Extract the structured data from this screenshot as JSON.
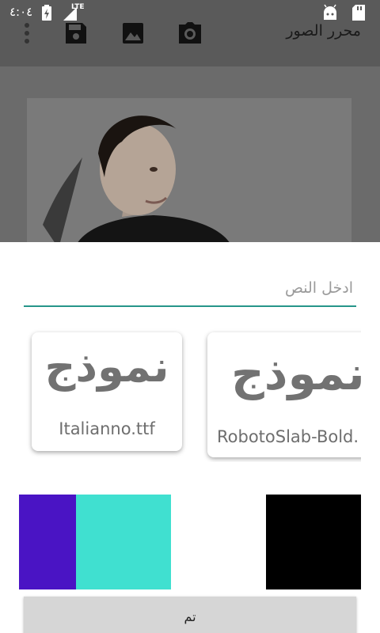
{
  "statusbar": {
    "time": "٤:٠٤",
    "network": "LTE"
  },
  "appbar": {
    "title": "محرر الصور",
    "actions": [
      "camera-icon",
      "image-icon",
      "save-icon",
      "more-icon"
    ]
  },
  "editor": {
    "text_placeholder": "ادخل النص"
  },
  "fonts": [
    {
      "sample": "نموذج",
      "name": "Italianno.ttf"
    },
    {
      "sample": "نموذج",
      "name": "RobotoSlab-Bold."
    }
  ],
  "colors": {
    "swatches": [
      "#4a14c4",
      "#40e0d0",
      "#ffffff",
      "#000000"
    ],
    "accent": "#26968a"
  },
  "footer": {
    "done_label": "تم"
  }
}
